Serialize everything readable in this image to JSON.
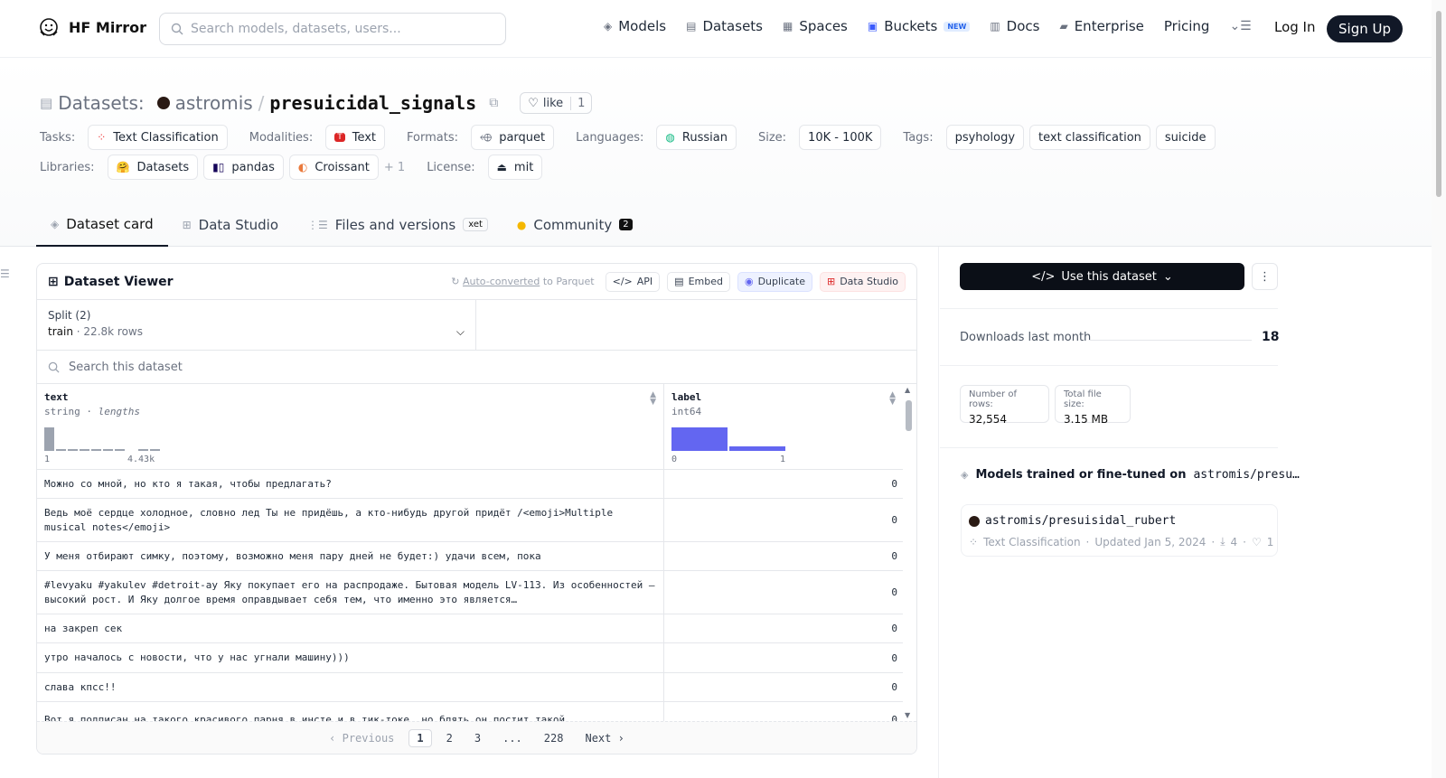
{
  "nav": {
    "brand": "HF Mirror",
    "search_placeholder": "Search models, datasets, users...",
    "links": {
      "models": "Models",
      "datasets": "Datasets",
      "spaces": "Spaces",
      "buckets": "Buckets",
      "buckets_badge": "NEW",
      "docs": "Docs",
      "enterprise": "Enterprise",
      "pricing": "Pricing"
    },
    "login": "Log In",
    "signup": "Sign Up"
  },
  "repo": {
    "kind": "Datasets:",
    "owner": "astromis",
    "slash": "/",
    "name": "presuicidal_signals",
    "like_label": "like",
    "like_count": "1"
  },
  "tags": {
    "tasks_label": "Tasks:",
    "tasks": "Text Classification",
    "modalities_label": "Modalities:",
    "modalities": "Text",
    "formats_label": "Formats:",
    "formats": "parquet",
    "languages_label": "Languages:",
    "languages": "Russian",
    "size_label": "Size:",
    "size": "10K - 100K",
    "tags_label": "Tags:",
    "tag_items": [
      "psyhology",
      "text classification",
      "suicide"
    ],
    "libraries_label": "Libraries:",
    "libraries": [
      "Datasets",
      "pandas",
      "Croissant"
    ],
    "libraries_more": "+ 1",
    "license_label": "License:",
    "license": "mit"
  },
  "tabs": {
    "card": "Dataset card",
    "studio": "Data Studio",
    "files": "Files and versions",
    "xet": "xet",
    "community": "Community",
    "community_count": "2"
  },
  "viewer": {
    "title": "Dataset Viewer",
    "autoconv_link": "Auto-converted",
    "autoconv_rest": "to Parquet",
    "api": "API",
    "embed": "Embed",
    "duplicate": "Duplicate",
    "data_studio": "Data Studio",
    "split_label": "Split (2)",
    "split_name": "train",
    "split_rows": "22.8k rows",
    "search_placeholder": "Search this dataset",
    "columns": {
      "text": {
        "name": "text",
        "type": "string",
        "sub": "lengths",
        "axis_min": "1",
        "axis_max": "4.43k"
      },
      "label": {
        "name": "label",
        "type": "int64",
        "axis_min": "0",
        "axis_max": "1"
      }
    },
    "rows": [
      {
        "text": "Можно со мной, но кто я такая, чтобы предлагать?",
        "label": "0"
      },
      {
        "text": "Ведь моё сердце холодное, словно лед Ты не придёшь, а кто-нибудь другой придёт /<emoji>Multiple musical notes</emoji>",
        "label": "0"
      },
      {
        "text": "У меня отбирают симку, поэтому, возможно меня пару дней не будет:) удачи всем, пока",
        "label": "0"
      },
      {
        "text": "#levyaku #yakulev #detroit-ay Яку покупает его на распродаже. Бытовая модель LV-113. Из особенностей — высокий рост. И Яку долгое время оправдывает себя тем, что именно это является…",
        "label": "0"
      },
      {
        "text": "на закреп сек",
        "label": "0"
      },
      {
        "text": "утро началось с новости, что у нас угнали машину)))",
        "label": "0"
      },
      {
        "text": "слава кпсс!!",
        "label": "0"
      },
      {
        "text": "Вот я подписан на такого красивого парня в инсте и в тик-токе, но блять он постит такой",
        "label": "0"
      }
    ],
    "pager": {
      "prev": "Previous",
      "pages": [
        "1",
        "2",
        "3",
        "...",
        "228"
      ],
      "next": "Next"
    }
  },
  "histograms": {
    "text_lengths": [
      1.0,
      0.08,
      0.08,
      0.08,
      0.08,
      0.08,
      0.08,
      0.0,
      0.08,
      0.08
    ],
    "label": [
      1.0,
      0.18
    ]
  },
  "sidebar": {
    "use_dataset": "Use this dataset",
    "downloads_label": "Downloads last month",
    "downloads": "18",
    "rows_label": "Number of rows:",
    "rows_value": "32,554",
    "size_label": "Total file size:",
    "size_value": "3.15 MB",
    "models_label": "Models trained or fine-tuned on",
    "models_target": "astromis/presu…",
    "model": {
      "name": "astromis/presuisidal_rubert",
      "task": "Text Classification",
      "updated": "Updated Jan 5, 2024",
      "downloads": "4",
      "likes": "1"
    }
  },
  "colors": {
    "accent_bar": "#6366f1",
    "dark": "#111827"
  }
}
